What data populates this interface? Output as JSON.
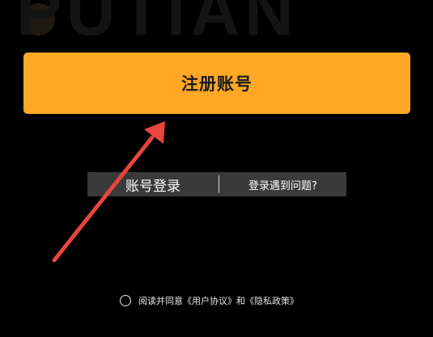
{
  "background": {
    "logo_text": "PUTIAN"
  },
  "register_button": {
    "label": "注册账号",
    "color": "#FFA826"
  },
  "login_bar": {
    "account_login_label": "账号登录",
    "login_problem_label": "登录遇到问题?"
  },
  "agreement": {
    "prefix": "阅读并同意",
    "user_agreement": "《用户协议》",
    "conjunction": "和",
    "privacy_policy": "《隐私政策》"
  },
  "annotation": {
    "arrow_color": "#E8453C"
  }
}
